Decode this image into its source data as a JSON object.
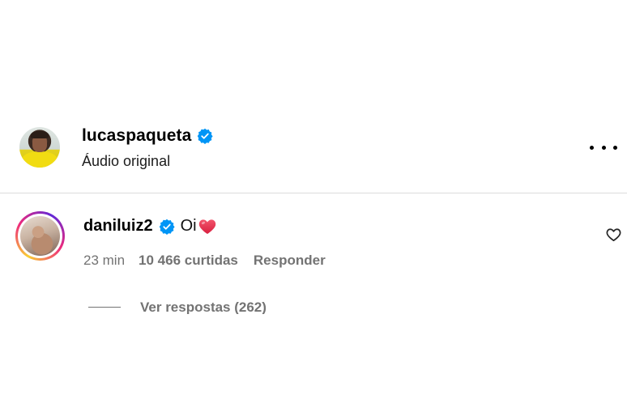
{
  "post": {
    "username": "lucaspaqueta",
    "subtitle": "Áudio original",
    "verified": true,
    "more_icon": "more-horizontal-icon"
  },
  "comment": {
    "username": "daniluiz2",
    "verified": true,
    "text": "Oi",
    "emoji": "heart-emoji",
    "time": "23 min",
    "likes": "10 466 curtidas",
    "reply_label": "Responder",
    "like_icon": "heart-outline-icon",
    "view_replies": "Ver respostas (262)"
  },
  "colors": {
    "verified_blue": "#0095f6",
    "heart_red": "#e8334d",
    "muted_text": "#737373",
    "divider": "#dbdbdb"
  }
}
